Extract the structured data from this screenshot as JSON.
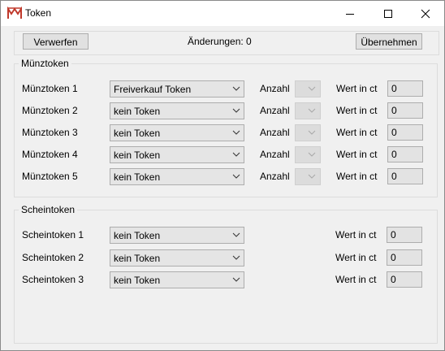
{
  "window": {
    "title": "Token"
  },
  "toolbar": {
    "discard_label": "Verwerfen",
    "changes_text": "Änderungen: 0",
    "apply_label": "Übernehmen"
  },
  "coin_group": {
    "title": "Münztoken",
    "rows": [
      {
        "label": "Münztoken 1",
        "selected": "Freiverkauf Token",
        "count_label": "Anzahl",
        "value_label": "Wert in ct",
        "value": "0"
      },
      {
        "label": "Münztoken 2",
        "selected": "kein Token",
        "count_label": "Anzahl",
        "value_label": "Wert in ct",
        "value": "0"
      },
      {
        "label": "Münztoken 3",
        "selected": "kein Token",
        "count_label": "Anzahl",
        "value_label": "Wert in ct",
        "value": "0"
      },
      {
        "label": "Münztoken 4",
        "selected": "kein Token",
        "count_label": "Anzahl",
        "value_label": "Wert in ct",
        "value": "0"
      },
      {
        "label": "Münztoken 5",
        "selected": "kein Token",
        "count_label": "Anzahl",
        "value_label": "Wert in ct",
        "value": "0"
      }
    ]
  },
  "note_group": {
    "title": "Scheintoken",
    "rows": [
      {
        "label": "Scheintoken 1",
        "selected": "kein Token",
        "value_label": "Wert in ct",
        "value": "0"
      },
      {
        "label": "Scheintoken 2",
        "selected": "kein Token",
        "value_label": "Wert in ct",
        "value": "0"
      },
      {
        "label": "Scheintoken 3",
        "selected": "kein Token",
        "value_label": "Wert in ct",
        "value": "0"
      }
    ]
  },
  "icons": {
    "app": "app-logo-icon",
    "minimize": "minimize-icon",
    "maximize": "maximize-icon",
    "close": "close-icon",
    "dropdown": "chevron-down-icon"
  },
  "colors": {
    "logo_red": "#c0392b",
    "disabled_field": "#e3e3e3"
  }
}
